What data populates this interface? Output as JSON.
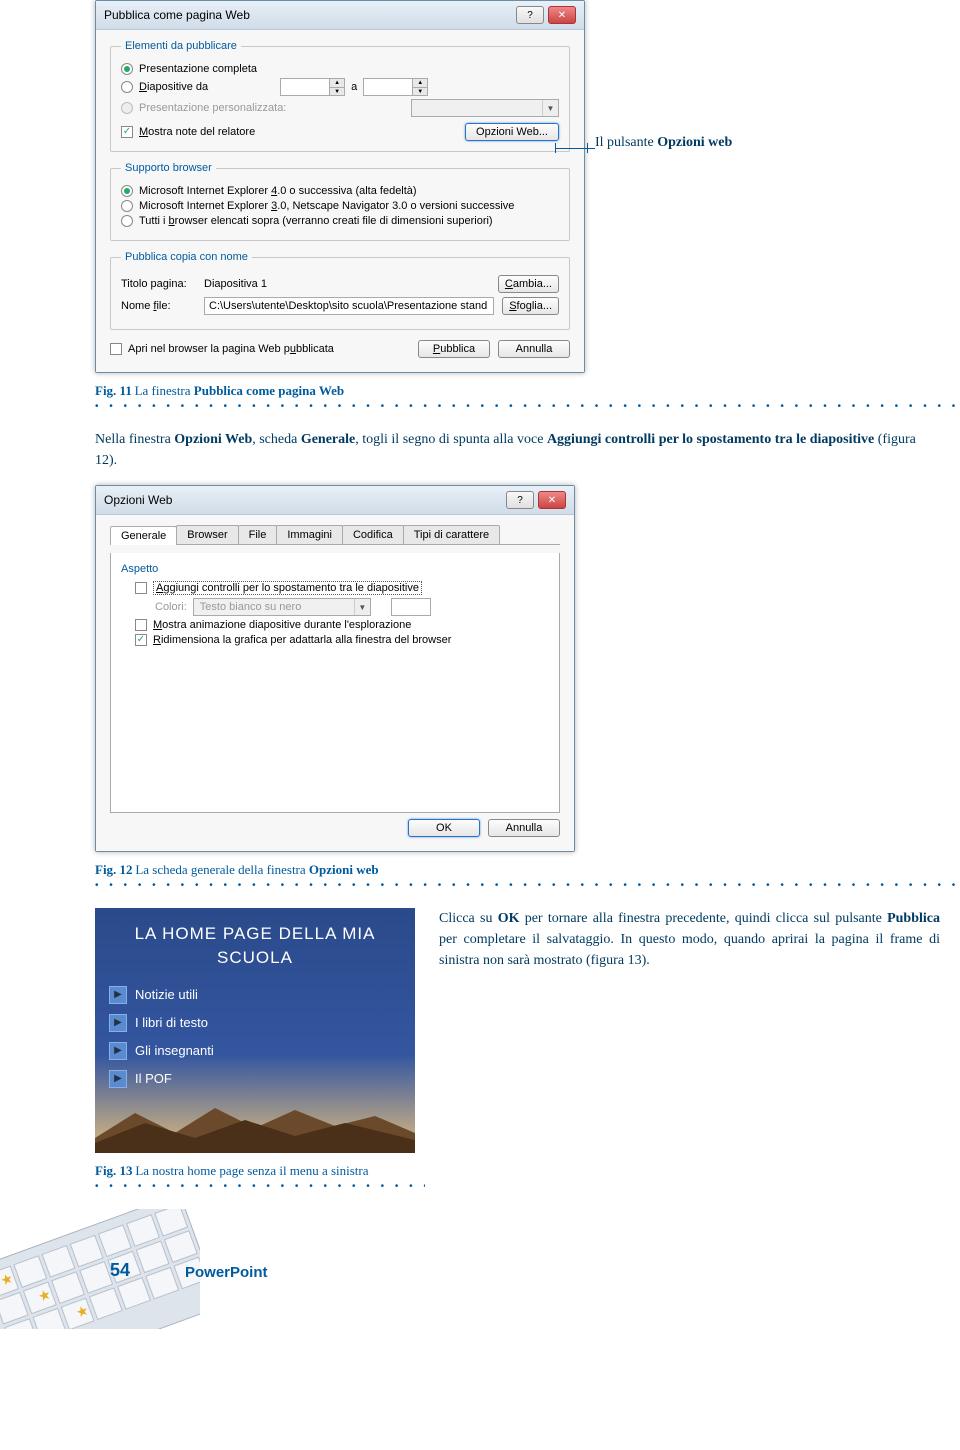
{
  "dialog1": {
    "title": "Pubblica come pagina Web",
    "fs1_legend": "Elementi da pubblicare",
    "opt_full": "Presentazione completa",
    "opt_slides_from": "Diapositive da",
    "label_a": "a",
    "opt_custom": "Presentazione personalizzata:",
    "chk_notes": "Mostra note del relatore",
    "btn_opzweb": "Opzioni Web...",
    "fs2_legend": "Supporto browser",
    "opt_ie4": "Microsoft Internet Explorer 4.0 o successiva (alta fedeltà)",
    "opt_ie3": "Microsoft Internet Explorer 3.0, Netscape Navigator 3.0 o versioni successive",
    "opt_all": "Tutti i browser elencati sopra (verranno creati file di dimensioni superiori)",
    "fs3_legend": "Pubblica copia con nome",
    "lbl_titolo": "Titolo pagina:",
    "val_titolo": "Diapositiva 1",
    "btn_cambia": "Cambia...",
    "lbl_nome": "Nome file:",
    "val_nome": "C:\\Users\\utente\\Desktop\\sito scuola\\Presentazione stand",
    "btn_sfoglia": "Sfoglia...",
    "chk_apri": "Apri nel browser la pagina Web pubblicata",
    "btn_pubblica": "Pubblica",
    "btn_annulla": "Annulla"
  },
  "annotation1": "Il pulsante Opzioni web",
  "fig11": {
    "num": "Fig. 11",
    "text": "La finestra ",
    "bold": "Pubblica come pagina Web"
  },
  "para1_a": "Nella finestra ",
  "para1_b": "Opzioni Web",
  "para1_c": ", scheda ",
  "para1_d": "Generale",
  "para1_e": ", togli il segno di spunta alla voce ",
  "para1_f": "Aggiungi controlli per lo spostamento tra le diapositive",
  "para1_g": " (figura 12).",
  "dialog2": {
    "title": "Opzioni Web",
    "tabs": [
      "Generale",
      "Browser",
      "File",
      "Immagini",
      "Codifica",
      "Tipi di carattere"
    ],
    "fs_legend": "Aspetto",
    "chk_aggiungi": "Aggiungi controlli per lo spostamento tra le diapositive",
    "lbl_colori": "Colori:",
    "combo_colori": "Testo bianco su nero",
    "chk_mostra": "Mostra animazione diapositive durante l'esplorazione",
    "chk_ridim": "Ridimensiona la grafica per adattarla alla finestra del browser",
    "btn_ok": "OK",
    "btn_annulla": "Annulla"
  },
  "fig12": {
    "num": "Fig. 12",
    "text": "La scheda generale della finestra ",
    "bold": "Opzioni web"
  },
  "preview13": {
    "title_l1": "LA HOME PAGE DELLA MIA",
    "title_l2": "SCUOLA",
    "items": [
      "Notizie utili",
      "I libri di testo",
      "Gli insegnanti",
      "Il POF"
    ]
  },
  "para2_a": "Clicca su ",
  "para2_b": "OK",
  "para2_c": " per tornare alla finestra precedente, quindi clicca sul pulsante ",
  "para2_d": "Pubblica",
  "para2_e": " per completare il salvataggio. In questo modo, quando aprirai la pagina il frame di sinistra non sarà mostrato (figura 13).",
  "fig13": {
    "num": "Fig. 13",
    "text": "La nostra home page senza il menu a sinistra"
  },
  "page_num": "54",
  "page_label": "PowerPoint"
}
